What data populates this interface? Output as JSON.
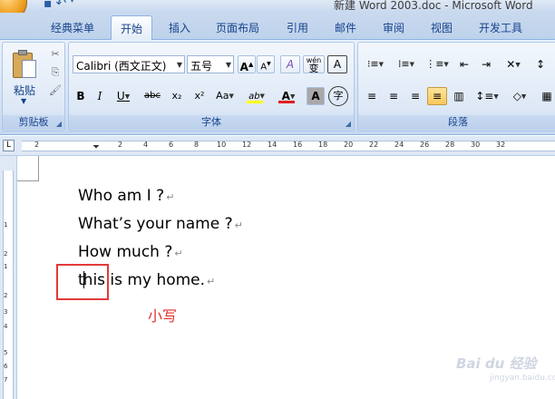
{
  "window": {
    "title": "新建 Word 2003.doc - Microsoft Word"
  },
  "quick_access": {
    "save_icon": "save-icon",
    "undo_icon": "undo-icon",
    "dropdown_icon": "chevron-down-icon"
  },
  "tabs": [
    {
      "label": "经典菜单",
      "active": false
    },
    {
      "label": "开始",
      "active": true
    },
    {
      "label": "插入",
      "active": false
    },
    {
      "label": "页面布局",
      "active": false
    },
    {
      "label": "引用",
      "active": false
    },
    {
      "label": "邮件",
      "active": false
    },
    {
      "label": "审阅",
      "active": false
    },
    {
      "label": "视图",
      "active": false
    },
    {
      "label": "开发工具",
      "active": false
    }
  ],
  "ribbon": {
    "clipboard": {
      "group_label": "剪贴板",
      "paste_label": "粘贴",
      "cut_glyph": "✂",
      "copy_glyph": "⎘",
      "format_painter_glyph": "🖌"
    },
    "font": {
      "group_label": "字体",
      "font_name": "Calibri (西文正文)",
      "font_size": "五号",
      "grow_font": "A",
      "shrink_font": "A",
      "clear_format": "A",
      "phonetic": "wén",
      "phonetic_char": "变",
      "char_border": "A",
      "bold": "B",
      "italic": "I",
      "underline": "U",
      "strikethrough": "abc",
      "subscript": "x₂",
      "superscript": "x²",
      "change_case": "Aa",
      "highlight": "ab",
      "font_color": "A",
      "char_shading": "A",
      "enclose_char": "字"
    },
    "paragraph": {
      "group_label": "段落"
    }
  },
  "ruler": {
    "corner": "L",
    "h_numbers": [
      "2",
      "2",
      "4",
      "6",
      "8",
      "10",
      "12",
      "14",
      "16",
      "18",
      "20",
      "22",
      "24",
      "26",
      "28",
      "30",
      "32"
    ],
    "v_numbers": [
      "1",
      "2",
      "1",
      "2",
      "3",
      "4",
      "5",
      "6",
      "7"
    ]
  },
  "document": {
    "lines": [
      {
        "text": "Who am I ?"
      },
      {
        "text": "What’s your name ?"
      },
      {
        "text": "How much ?"
      },
      {
        "pre": "t",
        "post": "his is my home."
      }
    ],
    "para_mark": "↵"
  },
  "annotation": {
    "label": "小写",
    "color": "#e03030"
  },
  "watermark": {
    "brand": "Bai du 经验",
    "url": "jingyan.baidu.com"
  },
  "colors": {
    "accent": "#15428b",
    "highlight_box": "#e23a3a",
    "font_color_bar": "#e02020",
    "highlight_bar": "#ffff00"
  }
}
